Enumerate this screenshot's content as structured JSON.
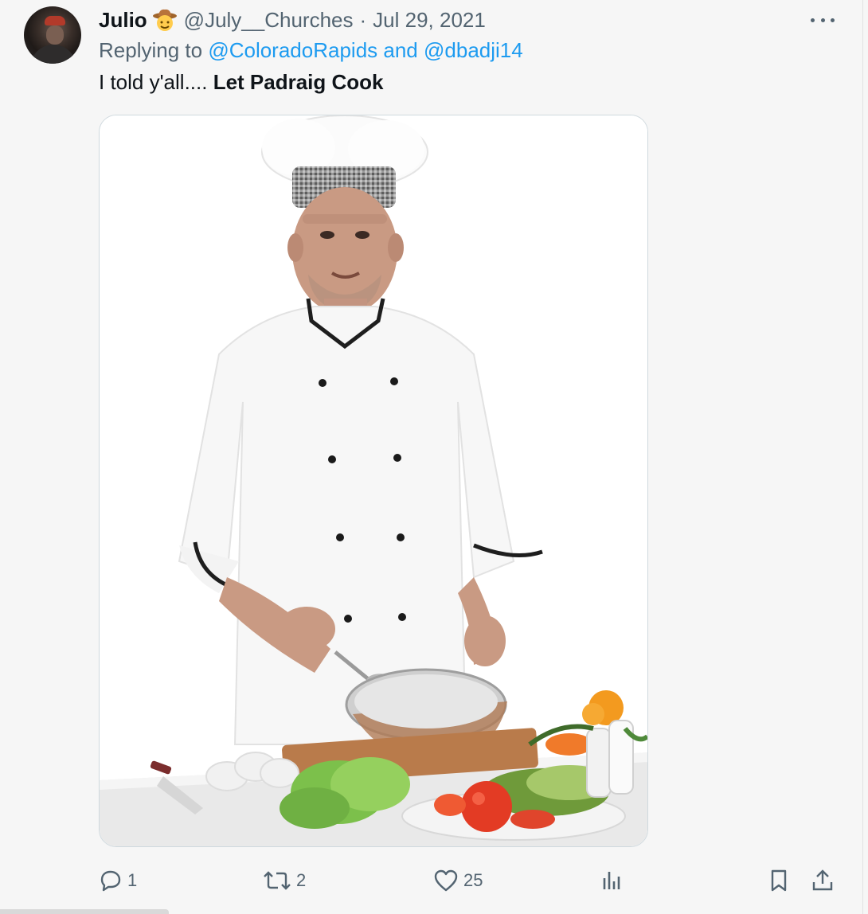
{
  "tweet": {
    "display_name": "Julio",
    "emoji_icon": "cowboy-hat-face-icon",
    "handle": "@July__Churches",
    "separator": "·",
    "date": "Jul 29, 2021",
    "reply_prefix": "Replying to",
    "mention_1": "@ColoradoRapids",
    "reply_and": "and",
    "mention_2": "@dbadji14",
    "text_plain": "I told y'all.... ",
    "text_bold": "Let Padraig Cook"
  },
  "actions": {
    "reply_count": "1",
    "retweet_count": "2",
    "like_count": "25",
    "icons": [
      "reply-icon",
      "retweet-icon",
      "like-icon",
      "views-icon",
      "bookmark-icon",
      "share-icon"
    ]
  },
  "colors": {
    "link": "#1d9bf0",
    "secondary_text": "#536471",
    "primary_text": "#0f1419",
    "background": "#f6f6f6"
  }
}
